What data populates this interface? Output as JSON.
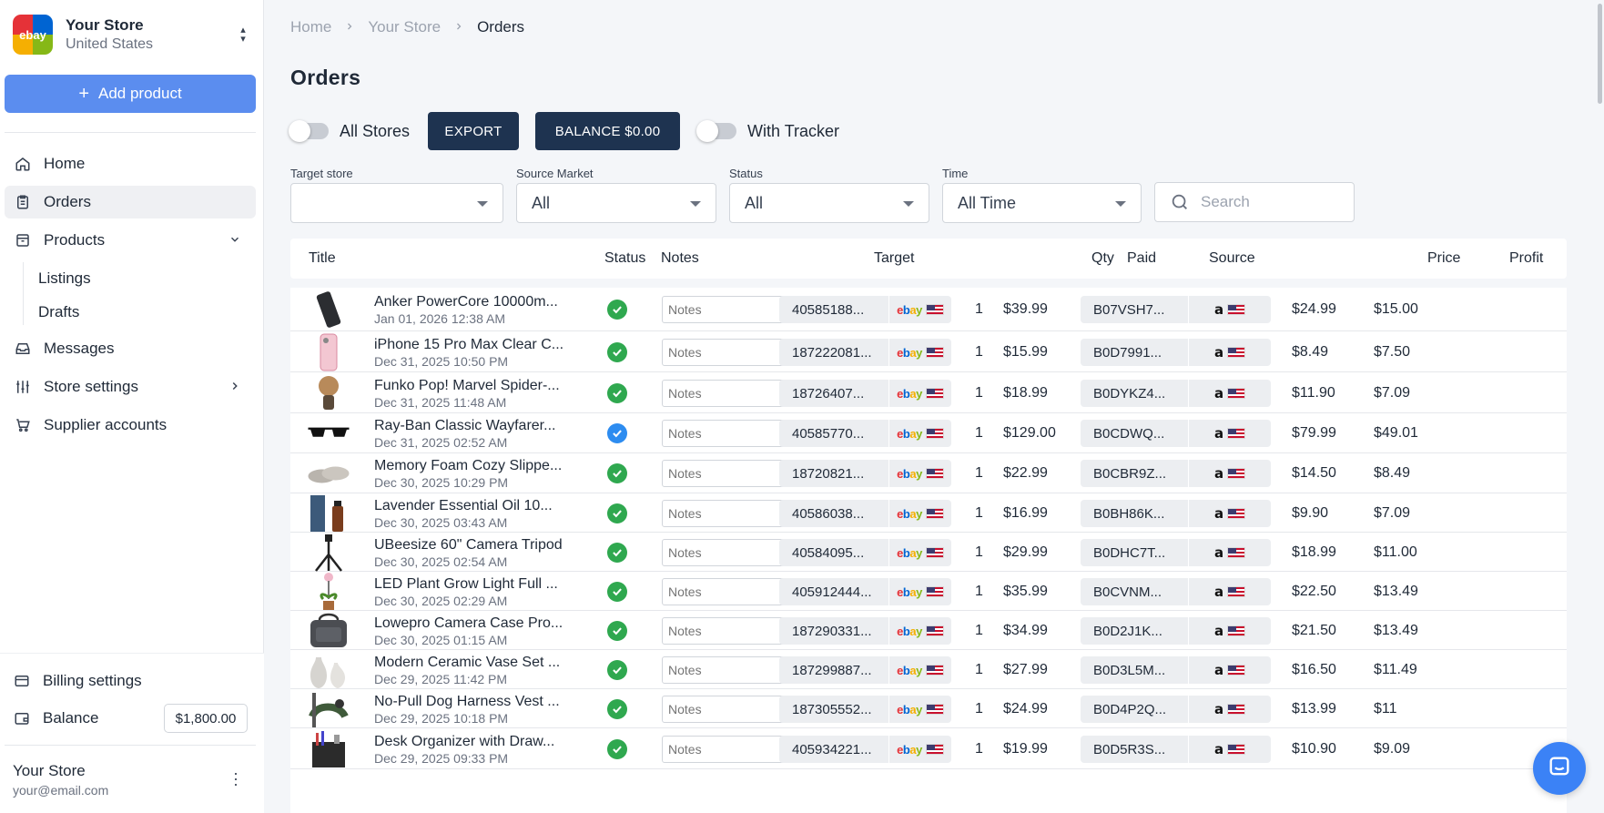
{
  "store": {
    "name": "Your Store",
    "country": "United States",
    "logo_text": "ebay"
  },
  "sidebar": {
    "add_product_label": "Add product",
    "nav": [
      {
        "label": "Home",
        "icon": "home-icon"
      },
      {
        "label": "Orders",
        "icon": "orders-icon",
        "active": true
      },
      {
        "label": "Products",
        "icon": "products-icon",
        "expanded": true
      },
      {
        "label": "Listings"
      },
      {
        "label": "Drafts"
      },
      {
        "label": "Messages",
        "icon": "inbox-icon"
      },
      {
        "label": "Store settings",
        "icon": "sliders-icon"
      },
      {
        "label": "Supplier accounts",
        "icon": "cart-icon"
      }
    ],
    "billing_label": "Billing settings",
    "balance_label": "Balance",
    "balance_value": "$1,800.00",
    "user_name": "Your Store",
    "user_email": "your@email.com"
  },
  "breadcrumb": [
    "Home",
    "Your Store",
    "Orders"
  ],
  "page_title": "Orders",
  "toolbar": {
    "all_stores_label": "All Stores",
    "export_label": "EXPORT",
    "balance_button_label": "BALANCE $0.00",
    "with_tracker_label": "With Tracker"
  },
  "filters": {
    "target_store": {
      "label": "Target store",
      "value": ""
    },
    "source_market": {
      "label": "Source Market",
      "value": "All"
    },
    "status": {
      "label": "Status",
      "value": "All"
    },
    "time": {
      "label": "Time",
      "value": "All Time"
    },
    "search_placeholder": "Search"
  },
  "table": {
    "columns": [
      "Title",
      "Status",
      "Notes",
      "Target",
      "Qty",
      "Paid",
      "Source",
      "Price",
      "Profit"
    ],
    "notes_placeholder": "Notes",
    "rows": [
      {
        "title": "Anker PowerCore 10000m...",
        "date": "Jan 01, 2026 12:38 AM",
        "status": "green",
        "target_id": "40585188...",
        "qty": "1",
        "paid": "$39.99",
        "source_id": "B07VSH7...",
        "price": "$24.99",
        "profit": "$15.00",
        "thumb": "powerbank"
      },
      {
        "title": "iPhone 15 Pro Max Clear C...",
        "date": "Dec 31, 2025 10:50 PM",
        "status": "green",
        "target_id": "187222081...",
        "qty": "1",
        "paid": "$15.99",
        "source_id": "B0D7991...",
        "price": "$8.49",
        "profit": "$7.50",
        "thumb": "case"
      },
      {
        "title": "Funko Pop! Marvel Spider-...",
        "date": "Dec 31, 2025 11:48 AM",
        "status": "green",
        "target_id": "18726407...",
        "qty": "1",
        "paid": "$18.99",
        "source_id": "B0DYKZ4...",
        "price": "$11.90",
        "profit": "$7.09",
        "thumb": "funko"
      },
      {
        "title": "Ray-Ban Classic Wayfarer...",
        "date": "Dec 31, 2025 02:52 AM",
        "status": "blue",
        "target_id": "40585770...",
        "qty": "1",
        "paid": "$129.00",
        "source_id": "B0CDWQ...",
        "price": "$79.99",
        "profit": "$49.01",
        "thumb": "glasses"
      },
      {
        "title": "Memory Foam Cozy Slippe...",
        "date": "Dec 30, 2025 10:29 PM",
        "status": "green",
        "target_id": "18720821...",
        "qty": "1",
        "paid": "$22.99",
        "source_id": "B0CBR9Z...",
        "price": "$14.50",
        "profit": "$8.49",
        "thumb": "slippers"
      },
      {
        "title": "Lavender Essential Oil 10...",
        "date": "Dec 30, 2025 03:43 AM",
        "status": "green",
        "target_id": "40586038...",
        "qty": "1",
        "paid": "$16.99",
        "source_id": "B0BH86K...",
        "price": "$9.90",
        "profit": "$7.09",
        "thumb": "oil"
      },
      {
        "title": "UBeesize 60\" Camera Tripod",
        "date": "Dec 30, 2025 02:54 AM",
        "status": "green",
        "target_id": "40584095...",
        "qty": "1",
        "paid": "$29.99",
        "source_id": "B0DHC7T...",
        "price": "$18.99",
        "profit": "$11.00",
        "thumb": "tripod"
      },
      {
        "title": "LED Plant Grow Light Full ...",
        "date": "Dec 30, 2025 02:29 AM",
        "status": "green",
        "target_id": "405912444...",
        "qty": "1",
        "paid": "$35.99",
        "source_id": "B0CVNM...",
        "price": "$22.50",
        "profit": "$13.49",
        "thumb": "plant"
      },
      {
        "title": "Lowepro Camera Case Pro...",
        "date": "Dec 30, 2025 01:15 AM",
        "status": "green",
        "target_id": "187290331...",
        "qty": "1",
        "paid": "$34.99",
        "source_id": "B0D2J1K...",
        "price": "$21.50",
        "profit": "$13.49",
        "thumb": "bag"
      },
      {
        "title": "Modern Ceramic Vase Set ...",
        "date": "Dec 29, 2025 11:42 PM",
        "status": "green",
        "target_id": "187299887...",
        "qty": "1",
        "paid": "$27.99",
        "source_id": "B0D3L5M...",
        "price": "$16.50",
        "profit": "$11.49",
        "thumb": "vase"
      },
      {
        "title": "No-Pull Dog Harness Vest ...",
        "date": "Dec 29, 2025 10:18 PM",
        "status": "green",
        "target_id": "187305552...",
        "qty": "1",
        "paid": "$24.99",
        "source_id": "B0D4P2Q...",
        "price": "$13.99",
        "profit": "$11",
        "thumb": "harness"
      },
      {
        "title": "Desk Organizer with Draw...",
        "date": "Dec 29, 2025 09:33 PM",
        "status": "green",
        "target_id": "405934221...",
        "qty": "1",
        "paid": "$19.99",
        "source_id": "B0D5R3S...",
        "price": "$10.90",
        "profit": "$9.09",
        "thumb": "organizer"
      }
    ]
  },
  "colors": {
    "primary": "#5b8def",
    "dark_button": "#1e3350",
    "status_green": "#2fa84f",
    "status_blue": "#2d8cf0",
    "chat": "#3b82f6"
  }
}
